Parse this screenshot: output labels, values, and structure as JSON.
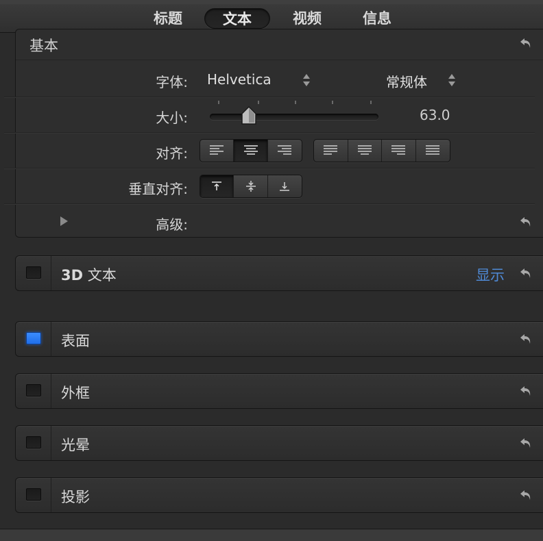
{
  "tabs": [
    {
      "label": "标题"
    },
    {
      "label": "文本",
      "active": true
    },
    {
      "label": "视频"
    },
    {
      "label": "信息"
    }
  ],
  "basic": {
    "title": "基本",
    "font": {
      "label": "字体:",
      "family": "Helvetica",
      "style": "常规体"
    },
    "size": {
      "label": "大小:",
      "value": "63.0"
    },
    "align": {
      "label": "对齐:",
      "selected": "center"
    },
    "valign": {
      "label": "垂直对齐:",
      "selected": "top"
    },
    "advanced": {
      "label": "高级:"
    }
  },
  "sections": [
    {
      "label_bold": "3D",
      "label": "文本",
      "checked": false,
      "show": "显示"
    },
    {
      "label": "表面",
      "checked": true
    },
    {
      "label": "外框",
      "checked": false
    },
    {
      "label": "光晕",
      "checked": false
    },
    {
      "label": "投影",
      "checked": false
    }
  ],
  "colors": {
    "accent": "#2b7af0",
    "link": "#4f8ad6",
    "panel": "#2e2e2e"
  },
  "icons": [
    "reset-icon",
    "stepper-icon",
    "slider-thumb",
    "align-left-icon",
    "align-center-icon",
    "align-right-icon",
    "justify-icon",
    "valign-top-icon",
    "valign-middle-icon",
    "valign-bottom-icon",
    "disclosure-triangle-icon",
    "checkbox"
  ]
}
